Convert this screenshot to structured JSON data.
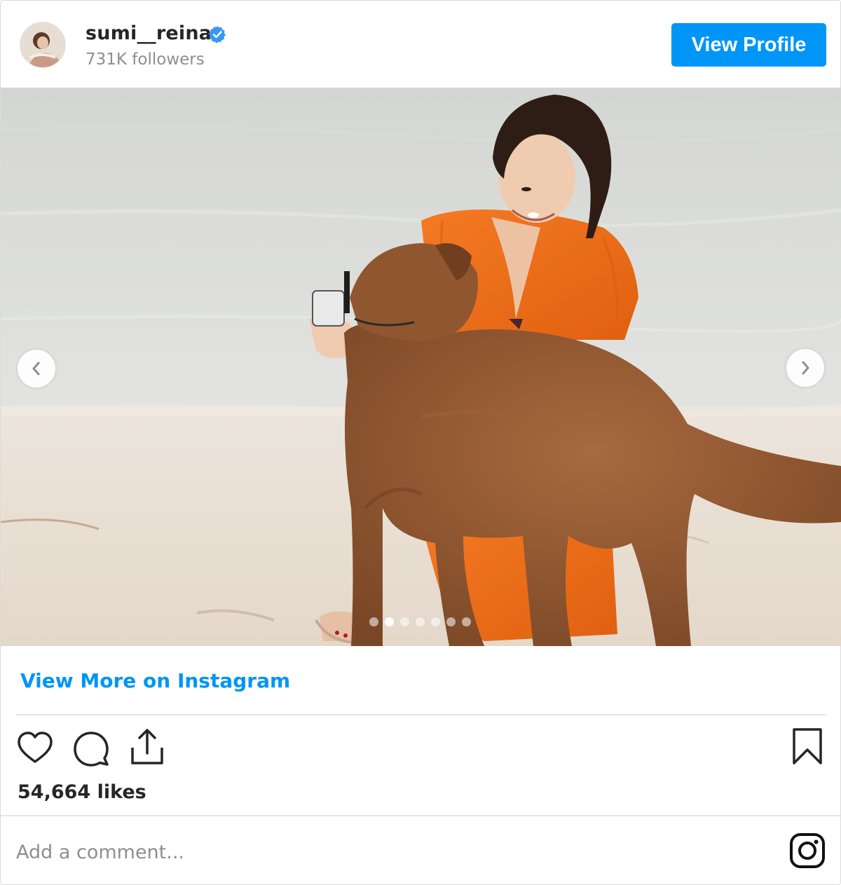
{
  "header": {
    "username": "sumi__reina",
    "followers": "731K followers",
    "view_profile_label": "View Profile",
    "verified_color": "#3897f0"
  },
  "carousel": {
    "slide_count": 7,
    "active_index": 1,
    "prev_icon": "chevron-left-icon",
    "next_icon": "chevron-right-icon"
  },
  "links": {
    "view_more": "View More on Instagram"
  },
  "actions": {
    "icons": [
      "heart-icon",
      "comment-icon",
      "share-icon",
      "bookmark-icon"
    ],
    "likes": "54,664 likes"
  },
  "comment": {
    "placeholder": "Add a comment..."
  },
  "colors": {
    "accent": "#0095f6",
    "text": "#262626",
    "muted": "#8e8e8e",
    "divider": "#e6e6e6"
  }
}
